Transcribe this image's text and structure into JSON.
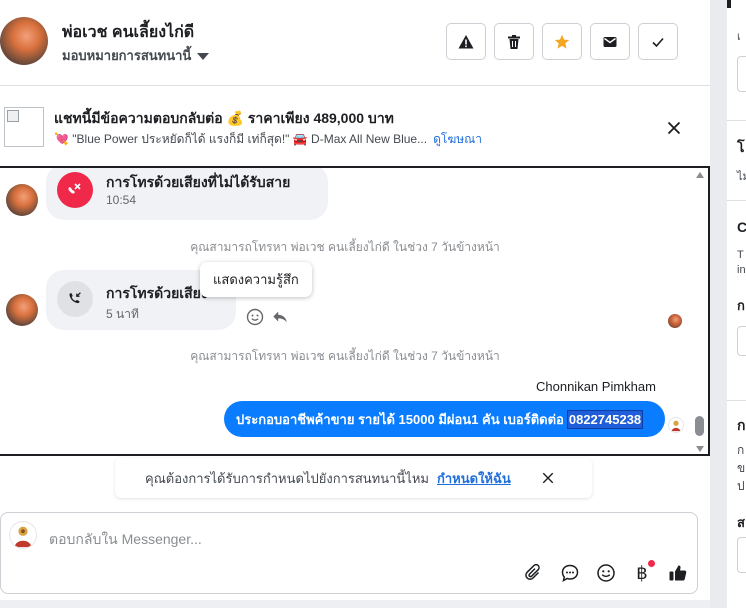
{
  "header": {
    "contact_name": "พ่อเวช คนเลี้ยงไก่ดี",
    "assign_label": "มอบหมายการสนทนานี้",
    "actions": [
      {
        "icon": "warning-icon",
        "color": "#1c1e21"
      },
      {
        "icon": "trash-icon",
        "color": "#1c1e21"
      },
      {
        "icon": "star-icon",
        "color": "#f5a623"
      },
      {
        "icon": "envelope-icon",
        "color": "#1c1e21"
      },
      {
        "icon": "checkmark-icon",
        "color": "#1c1e21"
      }
    ]
  },
  "ad_banner": {
    "title": "แชทนี้มีข้อความตอบกลับต่อ 💰 ราคาเพียง 489,000 บาท",
    "subtitle": "💘 \"Blue Power ประหยัดก็ได้ แรงก็มี เท่ก็สุด!\" 🚘 D-Max All New Blue...",
    "link": "ดูโฆษณา"
  },
  "conversation": {
    "missed_call": {
      "title": "การโทรด้วยเสียงที่ไม่ได้รับสาย",
      "time": "10:54"
    },
    "note_1": "คุณสามารถโทรหา พ่อเวช คนเลี้ยงไก่ดี ในช่วง 7 วันข้างหน้า",
    "voice_call": {
      "title": "การโทรด้วยเสียง",
      "duration": "5 นาที"
    },
    "tooltip": "แสดงความรู้สึก",
    "note_2": "คุณสามารถโทรหา พ่อเวช คนเลี้ยงไก่ดี ในช่วง 7 วันข้างหน้า",
    "sender": "Chonnikan Pimkham",
    "outgoing_message": "ประกอบอาชีพค้าขาย รายได้ 15000  มีผ่อน1 คัน เบอร์ติดต่อ",
    "outgoing_phone": "0822745238"
  },
  "suggestion": {
    "text": "คุณต้องการได้รับการกำหนดไปยังการสนทนานี้ไหม",
    "link": "กำหนดให้ฉัน"
  },
  "composer": {
    "placeholder": "ตอบกลับใน Messenger...",
    "tools": [
      "paperclip-icon",
      "chat-bubble-icon",
      "emoji-icon",
      "baht-icon",
      "thumbs-up-icon"
    ],
    "baht_symbol": "฿"
  },
  "right_panel": {
    "t1": "เ",
    "t2": "โ",
    "t3": "ไม",
    "t4": "C",
    "t5": "T",
    "t6": "in",
    "t7": "ก",
    "t8": "ก",
    "t9": "ก",
    "t10": "ข",
    "t11": "ป",
    "t12": "ส"
  },
  "colors": {
    "accent": "#0a7cff",
    "missed_call": "#f02849",
    "link": "#216fdb",
    "star": "#f5a623"
  }
}
